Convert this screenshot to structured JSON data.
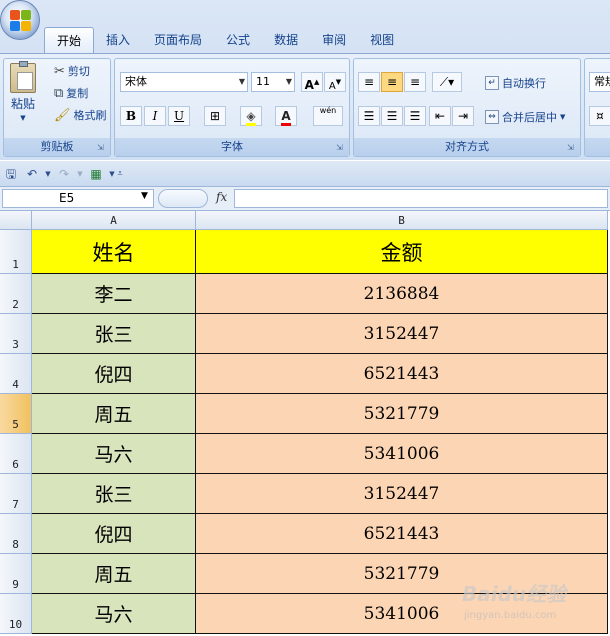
{
  "ribbon": {
    "tabs": [
      "开始",
      "插入",
      "页面布局",
      "公式",
      "数据",
      "审阅",
      "视图"
    ],
    "clipboard": {
      "paste": "粘贴",
      "cut": "剪切",
      "copy": "复制",
      "format_painter": "格式刷",
      "label": "剪贴板"
    },
    "font": {
      "name": "宋体",
      "size": "11",
      "grow": "A",
      "shrink": "A",
      "bold": "B",
      "italic": "I",
      "underline": "U",
      "label": "字体",
      "phonetic": "wén"
    },
    "alignment": {
      "wrap": "自动换行",
      "merge": "合并后居中",
      "label": "对齐方式"
    },
    "number": {
      "format_partial": "常规"
    }
  },
  "formula_bar": {
    "name_box": "E5",
    "fx": "fx",
    "formula": ""
  },
  "columns": [
    "A",
    "B"
  ],
  "rows": [
    {
      "num": "1",
      "name": "姓名",
      "amount": "金额"
    },
    {
      "num": "2",
      "name": "李二",
      "amount": "2136884"
    },
    {
      "num": "3",
      "name": "张三",
      "amount": "3152447"
    },
    {
      "num": "4",
      "name": "倪四",
      "amount": "6521443"
    },
    {
      "num": "5",
      "name": "周五",
      "amount": "5321779"
    },
    {
      "num": "6",
      "name": "马六",
      "amount": "5341006"
    },
    {
      "num": "7",
      "name": "张三",
      "amount": "3152447"
    },
    {
      "num": "8",
      "name": "倪四",
      "amount": "6521443"
    },
    {
      "num": "9",
      "name": "周五",
      "amount": "5321779"
    },
    {
      "num": "10",
      "name": "马六",
      "amount": "5341006"
    }
  ],
  "selected_row": "5",
  "colors": {
    "header_fill": "#ffff00",
    "name_fill": "#d8e4bc",
    "amount_fill": "#fcd5b4"
  },
  "watermark": {
    "brand": "Baidu经验",
    "url": "jingyan.baidu.com"
  }
}
